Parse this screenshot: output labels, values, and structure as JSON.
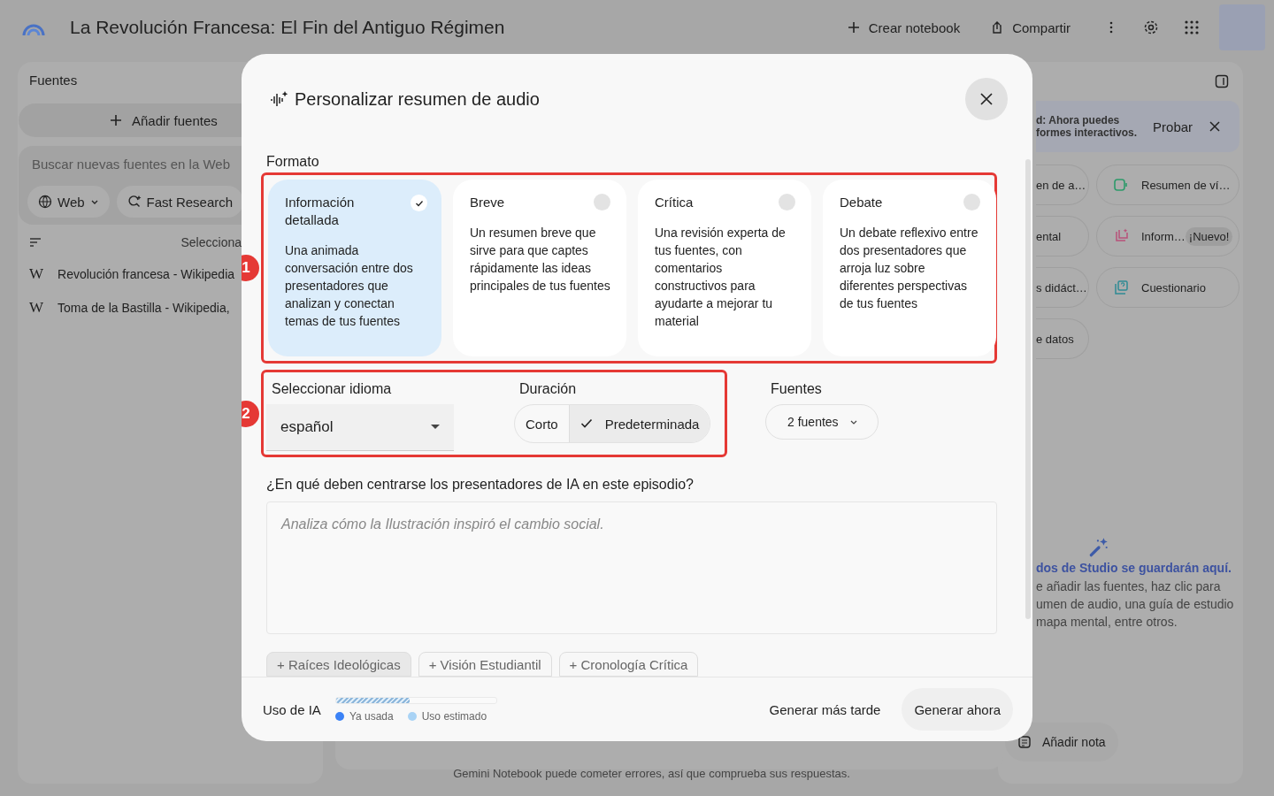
{
  "app": {
    "title": "La Revolución Francesa: El Fin del Antiguo Régimen",
    "actions": [
      {
        "kind": "create",
        "label": "Crear notebook"
      },
      {
        "kind": "share",
        "label": "Compartir"
      }
    ]
  },
  "sources": {
    "title": "Fuentes",
    "add_button": "Añadir fuentes",
    "search": {
      "placeholder": "Buscar nuevas fuentes en la Web",
      "source_chip": "Web",
      "mode_chip": "Fast Research"
    },
    "select_all": "Selecciona",
    "items": [
      {
        "favicon": "W",
        "title": "Revolución francesa - Wikipedia"
      },
      {
        "favicon": "W",
        "title": "Toma de la Bastilla - Wikipedia,"
      }
    ]
  },
  "studio": {
    "banner": {
      "lines": [
        "d: Ahora puedes",
        "formes interactivos."
      ],
      "action": "Probar"
    },
    "tools": [
      {
        "kind": "partial",
        "label": "en de a…"
      },
      {
        "kind": "video",
        "label": "Resumen de ví…"
      },
      {
        "kind": "partial",
        "label": "ental"
      },
      {
        "kind": "report",
        "label": "Inform…",
        "badge": "¡Nuevo!"
      },
      {
        "kind": "partial",
        "label": "s didáct…"
      },
      {
        "kind": "quiz",
        "label": "Cuestionario"
      },
      {
        "kind": "partial",
        "label": "e datos"
      }
    ],
    "empty": {
      "title": "dos de Studio se guardarán aquí.",
      "lines": [
        "e añadir las fuentes, haz clic para",
        "umen de audio, una guía de estudio",
        "mapa mental, entre otros."
      ]
    },
    "note_button": "Añadir nota"
  },
  "disclaimer": "Gemini Notebook puede cometer errores, así que comprueba sus respuestas.",
  "dialog": {
    "title": "Personalizar resumen de audio",
    "format_label": "Formato",
    "formats": [
      {
        "title": "Información detallada",
        "description": "Una animada conversación entre dos presentadores que analizan y conectan temas de tus fuentes",
        "selected": true
      },
      {
        "title": "Breve",
        "description": "Un resumen breve que sirve para que captes rápidamente las ideas principales de tus fuentes",
        "selected": false
      },
      {
        "title": "Crítica",
        "description": "Una revisión experta de tus fuentes, con comentarios constructivos para ayudarte a mejorar tu material",
        "selected": false
      },
      {
        "title": "Debate",
        "description": "Un debate reflexivo entre dos presentadores que arroja luz sobre diferentes perspectivas de tus fuentes",
        "selected": false
      }
    ],
    "language": {
      "label": "Seleccionar idioma",
      "value": "español"
    },
    "duration": {
      "label": "Duración",
      "options": [
        {
          "label": "Corto",
          "selected": false
        },
        {
          "label": "Predeterminada",
          "selected": true
        }
      ]
    },
    "sources": {
      "label": "Fuentes",
      "value": "2 fuentes"
    },
    "focus": {
      "label": "¿En qué deben centrarse los presentadores de IA en este episodio?",
      "placeholder": "Analiza cómo la Ilustración inspiró el cambio social."
    },
    "suggestions": [
      {
        "label": "+ Raíces Ideológicas",
        "selected": true
      },
      {
        "label": "+ Visión Estudiantil",
        "selected": false
      },
      {
        "label": "+ Cronología Crítica",
        "selected": false
      }
    ],
    "usage": {
      "label": "Uso de IA",
      "level": 0.46,
      "legend": [
        {
          "label": "Ya usada",
          "color": "#3b82f6"
        },
        {
          "label": "Uso estimado",
          "color": "#a9d3f5"
        }
      ]
    },
    "buttons": {
      "later": "Generar más tarde",
      "now": "Generar ahora"
    }
  },
  "annotations": [
    {
      "number": "1"
    },
    {
      "number": "2"
    }
  ]
}
